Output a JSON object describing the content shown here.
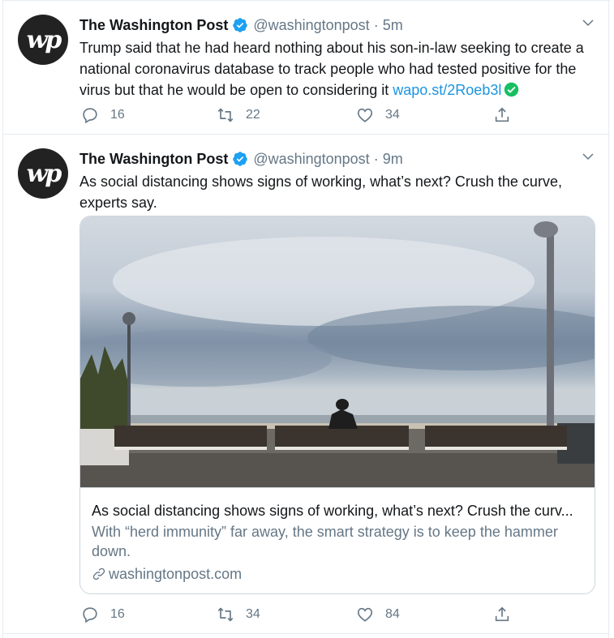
{
  "colors": {
    "accent": "#1b95e0",
    "verified": "#1da1f2",
    "link_check": "#17bf63",
    "secondary_text": "#657786",
    "border": "#e6ecf0"
  },
  "tweets": [
    {
      "author_name": "The Washington Post",
      "handle": "@washingtonpost",
      "separator": "·",
      "time": "5m",
      "avatar_text": "wp",
      "text": "Trump said that he had heard nothing about his son-in-law seeking to create a national coronavirus database to track people who had tested positive for the virus but that he would be open to considering it ",
      "link": "wapo.st/2Roeb3l",
      "actions": {
        "reply_count": "16",
        "retweet_count": "22",
        "like_count": "34"
      },
      "icons": [
        "verified-badge-icon",
        "chevron-down-icon",
        "check-circle-icon",
        "reply-icon",
        "retweet-icon",
        "like-icon",
        "share-icon"
      ]
    },
    {
      "author_name": "The Washington Post",
      "handle": "@washingtonpost",
      "separator": "·",
      "time": "9m",
      "avatar_text": "wp",
      "text": "As social distancing shows signs of working, what’s next? Crush the curve, experts say.",
      "card": {
        "title": "As social distancing shows signs of working, what’s next? Crush the curv...",
        "description": "With “herd immunity” far away, the smart strategy is to keep the hammer down.",
        "domain": "washingtonpost.com"
      },
      "actions": {
        "reply_count": "16",
        "retweet_count": "34",
        "like_count": "84"
      },
      "icons": [
        "verified-badge-icon",
        "chevron-down-icon",
        "link-icon",
        "reply-icon",
        "retweet-icon",
        "like-icon",
        "share-icon"
      ]
    }
  ]
}
